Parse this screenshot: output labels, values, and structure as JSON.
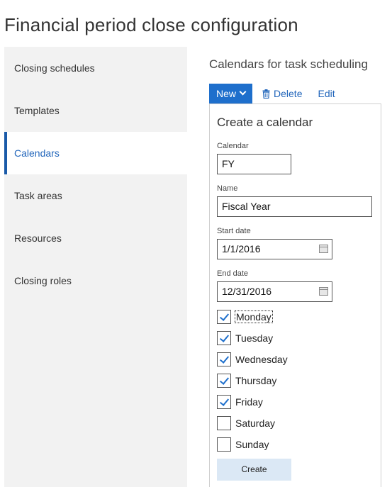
{
  "page": {
    "title": "Financial period close configuration"
  },
  "sidebar": {
    "items": [
      {
        "label": "Closing schedules"
      },
      {
        "label": "Templates"
      },
      {
        "label": "Calendars"
      },
      {
        "label": "Task areas"
      },
      {
        "label": "Resources"
      },
      {
        "label": "Closing roles"
      }
    ],
    "active_item": "Calendars"
  },
  "main": {
    "section_title": "Calendars for task scheduling"
  },
  "toolbar": {
    "new_label": "New",
    "delete_label": "Delete",
    "edit_label": "Edit"
  },
  "dialog": {
    "title": "Create a calendar",
    "calendar": {
      "label": "Calendar",
      "value": "FY"
    },
    "name": {
      "label": "Name",
      "value": "Fiscal Year"
    },
    "start_date": {
      "label": "Start date",
      "value": "1/1/2016"
    },
    "end_date": {
      "label": "End date",
      "value": "12/31/2016"
    },
    "days": [
      {
        "label": "Monday",
        "checked": true
      },
      {
        "label": "Tuesday",
        "checked": true
      },
      {
        "label": "Wednesday",
        "checked": true
      },
      {
        "label": "Thursday",
        "checked": true
      },
      {
        "label": "Friday",
        "checked": true
      },
      {
        "label": "Saturday",
        "checked": false
      },
      {
        "label": "Sunday",
        "checked": false
      }
    ],
    "create_label": "Create"
  },
  "colors": {
    "accent": "#1e6fcc",
    "active_bar": "#1a5aa8",
    "sidebar_bg": "#f2f2f2",
    "create_bg": "#dbe8f5"
  },
  "icons": {
    "new_menu": "chevron-down-icon",
    "delete": "trash-icon",
    "date_picker": "calendar-icon",
    "checkbox": "checkmark-icon"
  }
}
